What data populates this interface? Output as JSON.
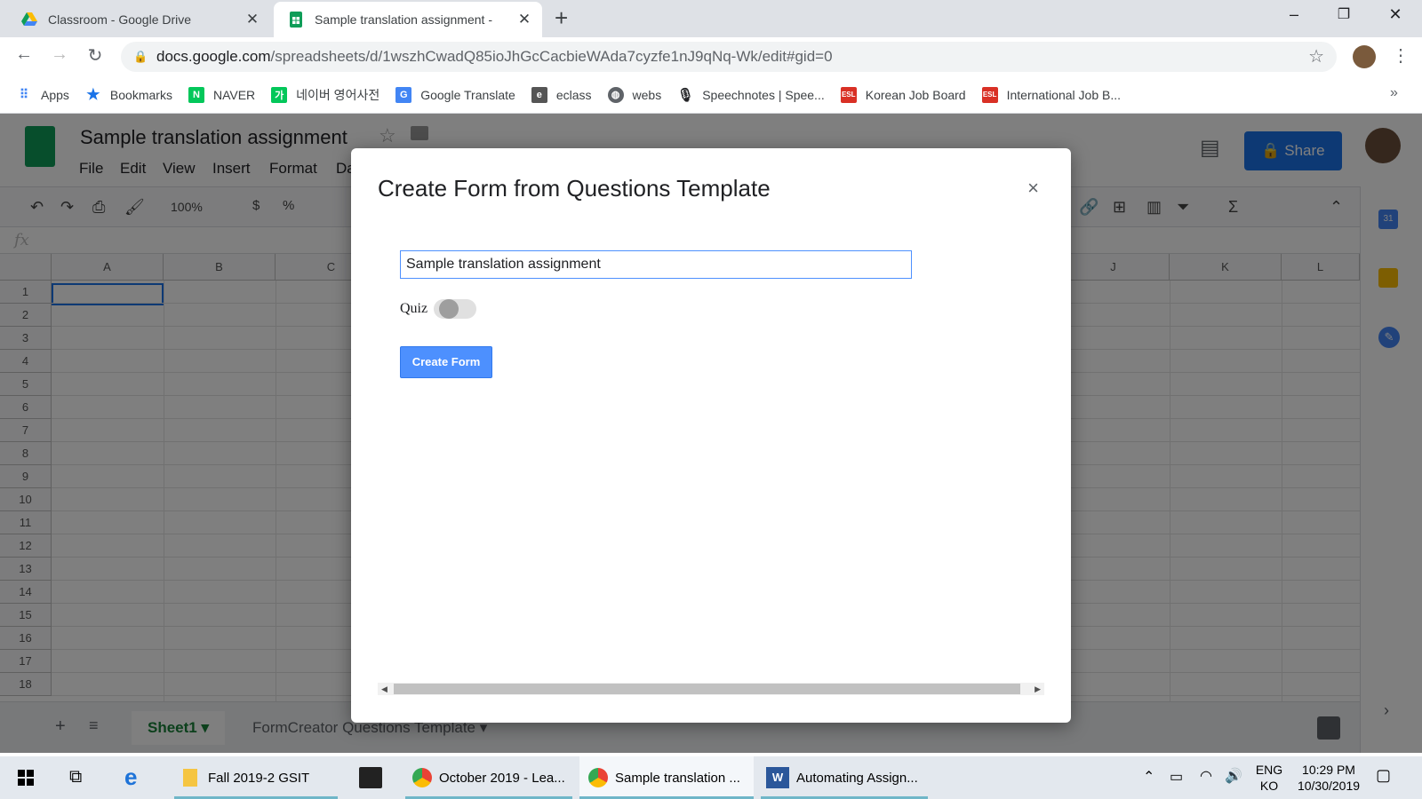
{
  "browser": {
    "tabs": [
      {
        "title": "Classroom - Google Drive",
        "icon": "drive-icon",
        "active": false
      },
      {
        "title": "Sample translation assignment -",
        "icon": "sheets-icon",
        "active": true
      }
    ],
    "new_tab": "+",
    "window_controls": {
      "minimize": "–",
      "restore": "❐",
      "close": "✕"
    },
    "url_host": "docs.google.com",
    "url_path": "/spreadsheets/d/1wszhCwadQ85ioJhGcCacbieWAda7cyzfe1nJ9qNq-Wk/edit#gid=0",
    "bookmarks": [
      {
        "label": "Apps",
        "icon": "apps-grid-icon",
        "color": "#4285f4"
      },
      {
        "label": "Bookmarks",
        "icon": "star-icon",
        "color": "#1a73e8"
      },
      {
        "label": "NAVER",
        "icon": "naver-icon",
        "color": "#03c75a"
      },
      {
        "label": "네이버 영어사전",
        "icon": "naver-dict-icon",
        "color": "#03c75a"
      },
      {
        "label": "Google Translate",
        "icon": "translate-icon",
        "color": "#4285f4"
      },
      {
        "label": "eclass",
        "icon": "eclass-icon",
        "color": "#555555"
      },
      {
        "label": "webs",
        "icon": "globe-icon",
        "color": "#5f6368"
      },
      {
        "label": "Speechnotes | Spee...",
        "icon": "mic-icon",
        "color": "#202124"
      },
      {
        "label": "Korean Job Board",
        "icon": "eslcafe-icon",
        "color": "#d93025"
      },
      {
        "label": "International Job B...",
        "icon": "eslcafe-icon",
        "color": "#d93025"
      }
    ],
    "more": "»"
  },
  "sheets": {
    "doc_title": "Sample translation assignment",
    "menu": [
      "File",
      "Edit",
      "View",
      "Insert",
      "Format",
      "Da"
    ],
    "share_label": "Share",
    "zoom": "100%",
    "fx": "fx",
    "columns": [
      "A",
      "B",
      "C",
      "J",
      "K",
      "L"
    ],
    "rows": [
      "1",
      "2",
      "3",
      "4",
      "5",
      "6",
      "7",
      "8",
      "9",
      "10",
      "11",
      "12",
      "13",
      "14",
      "15",
      "16",
      "17",
      "18"
    ],
    "sheet_tabs": [
      "Sheet1",
      "FormCreator Questions Template"
    ]
  },
  "dialog": {
    "title": "Create Form from Questions Template",
    "close": "×",
    "form_name_value": "Sample translation assignment",
    "quiz_label": "Quiz",
    "quiz_enabled": false,
    "create_button": "Create Form"
  },
  "taskbar": {
    "apps": [
      {
        "label": "Fall 2019-2 GSIT",
        "icon": "folder-icon"
      },
      {
        "label": "October 2019 - Lea...",
        "icon": "chrome-icon"
      },
      {
        "label": "Sample translation ...",
        "icon": "chrome-icon"
      },
      {
        "label": "Automating Assign...",
        "icon": "word-icon"
      }
    ],
    "lang_top": "ENG",
    "lang_bottom": "KO",
    "time": "10:29 PM",
    "date": "10/30/2019"
  }
}
